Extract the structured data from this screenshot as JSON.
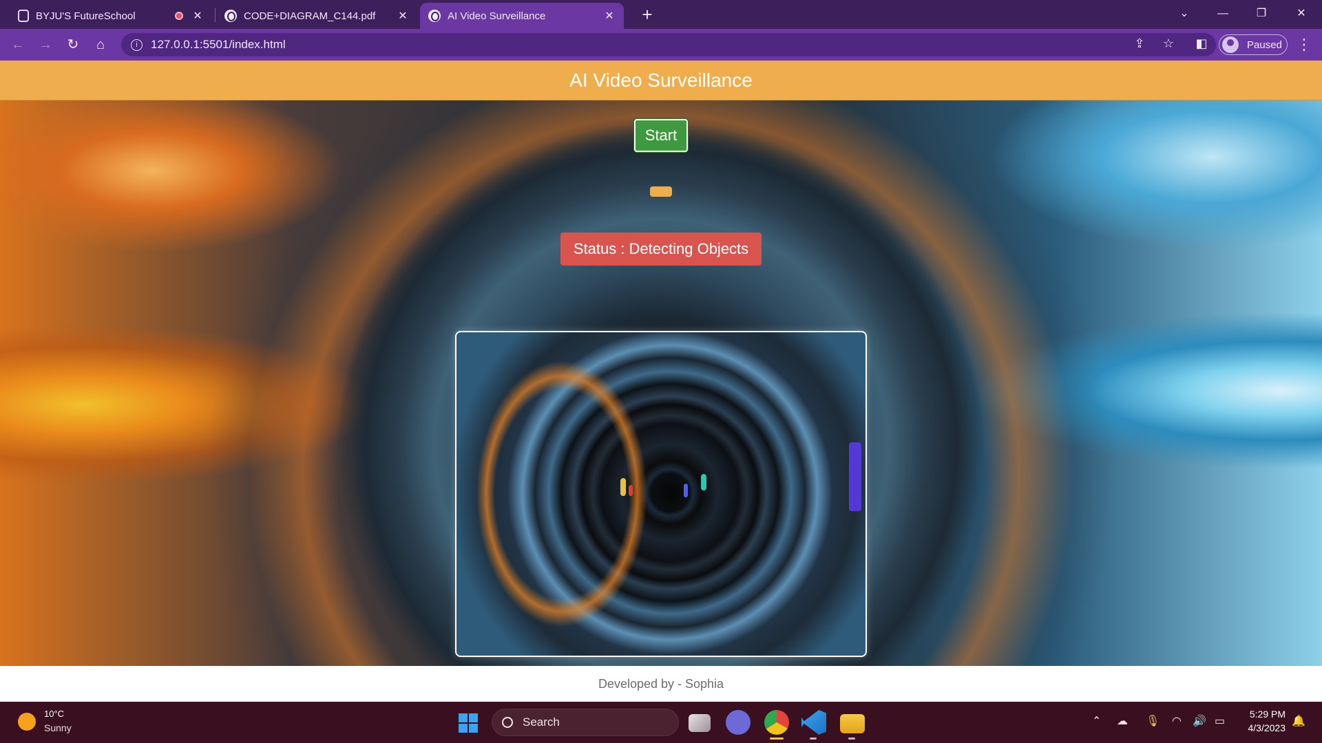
{
  "browser": {
    "tabs": [
      {
        "title": "BYJU'S FutureSchool",
        "recording": true
      },
      {
        "title": "CODE+DIAGRAM_C144.pdf"
      },
      {
        "title": "AI Video Surveillance",
        "active": true
      }
    ],
    "new_tab_label": "+",
    "address": "127.0.0.1:5501/index.html",
    "profile_label": "Paused",
    "accent_color": "#6b38a3"
  },
  "page": {
    "header_title": "AI Video Surveillance",
    "start_button": "Start",
    "status_text": "Status : Detecting Objects",
    "footer_text": "Developed by - Sophia",
    "header_color": "#f0ad4e",
    "start_color": "#3f9a3f",
    "status_color": "#d9534f"
  },
  "taskbar": {
    "weather_temp": "10°C",
    "weather_desc": "Sunny",
    "search_placeholder": "Search",
    "time": "5:29 PM",
    "date": "4/3/2023"
  }
}
